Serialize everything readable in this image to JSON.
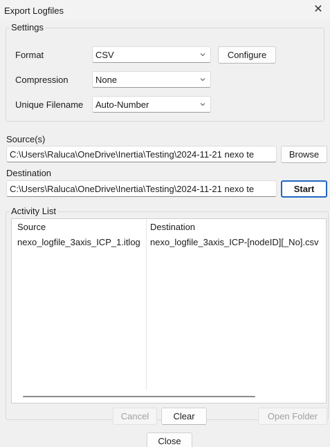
{
  "window": {
    "title": "Export Logfiles"
  },
  "settings": {
    "group_label": "Settings",
    "format": {
      "label": "Format",
      "value": "CSV",
      "configure_label": "Configure"
    },
    "compression": {
      "label": "Compression",
      "value": "None"
    },
    "unique_filename": {
      "label": "Unique Filename",
      "value": "Auto-Number"
    }
  },
  "sources": {
    "label": "Source(s)",
    "value": "C:\\Users\\Raluca\\OneDrive\\Inertia\\Testing\\2024-11-21 nexo te",
    "browse_label": "Browse"
  },
  "destination": {
    "label": "Destination",
    "value": "C:\\Users\\Raluca\\OneDrive\\Inertia\\Testing\\2024-11-21 nexo te",
    "start_label": "Start"
  },
  "activity": {
    "group_label": "Activity List",
    "columns": [
      "Source",
      "Destination"
    ],
    "rows": [
      [
        "nexo_logfile_3axis_ICP_1.itlog",
        "nexo_logfile_3axis_ICP-[nodeID][_No].csv"
      ]
    ]
  },
  "actions": {
    "cancel_label": "Cancel",
    "clear_label": "Clear",
    "open_folder_label": "Open Folder",
    "close_label": "Close"
  }
}
